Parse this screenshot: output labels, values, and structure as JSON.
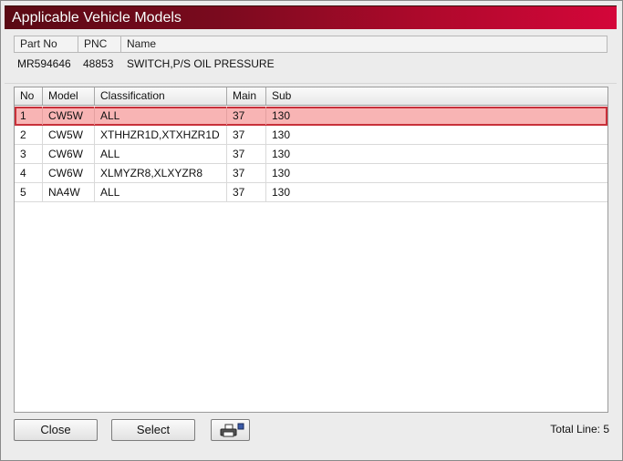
{
  "window": {
    "title": "Applicable Vehicle Models"
  },
  "part": {
    "headers": {
      "part_no": "Part No",
      "pnc": "PNC",
      "name": "Name"
    },
    "values": {
      "part_no": "MR594646",
      "pnc": "48853",
      "name": "SWITCH,P/S OIL PRESSURE"
    }
  },
  "grid": {
    "columns": [
      "No",
      "Model",
      "Classification",
      "Main",
      "Sub"
    ],
    "rows": [
      {
        "no": "1",
        "model": "CW5W",
        "classification": "ALL",
        "main": "37",
        "sub": "130"
      },
      {
        "no": "2",
        "model": "CW5W",
        "classification": "XTHHZR1D,XTXHZR1D",
        "main": "37",
        "sub": "130"
      },
      {
        "no": "3",
        "model": "CW6W",
        "classification": "ALL",
        "main": "37",
        "sub": "130"
      },
      {
        "no": "4",
        "model": "CW6W",
        "classification": "XLMYZR8,XLXYZR8",
        "main": "37",
        "sub": "130"
      },
      {
        "no": "5",
        "model": "NA4W",
        "classification": "ALL",
        "main": "37",
        "sub": "130"
      }
    ],
    "selected_row": "1"
  },
  "footer": {
    "close_label": "Close",
    "select_label": "Select",
    "print_icon": "printer-icon",
    "total_text": "Total Line: 5"
  },
  "colors": {
    "title_dark": "#5a0a14",
    "title_bright": "#d4063a",
    "selected_fill": "#f8b4b4",
    "selected_border": "#c8303a"
  }
}
